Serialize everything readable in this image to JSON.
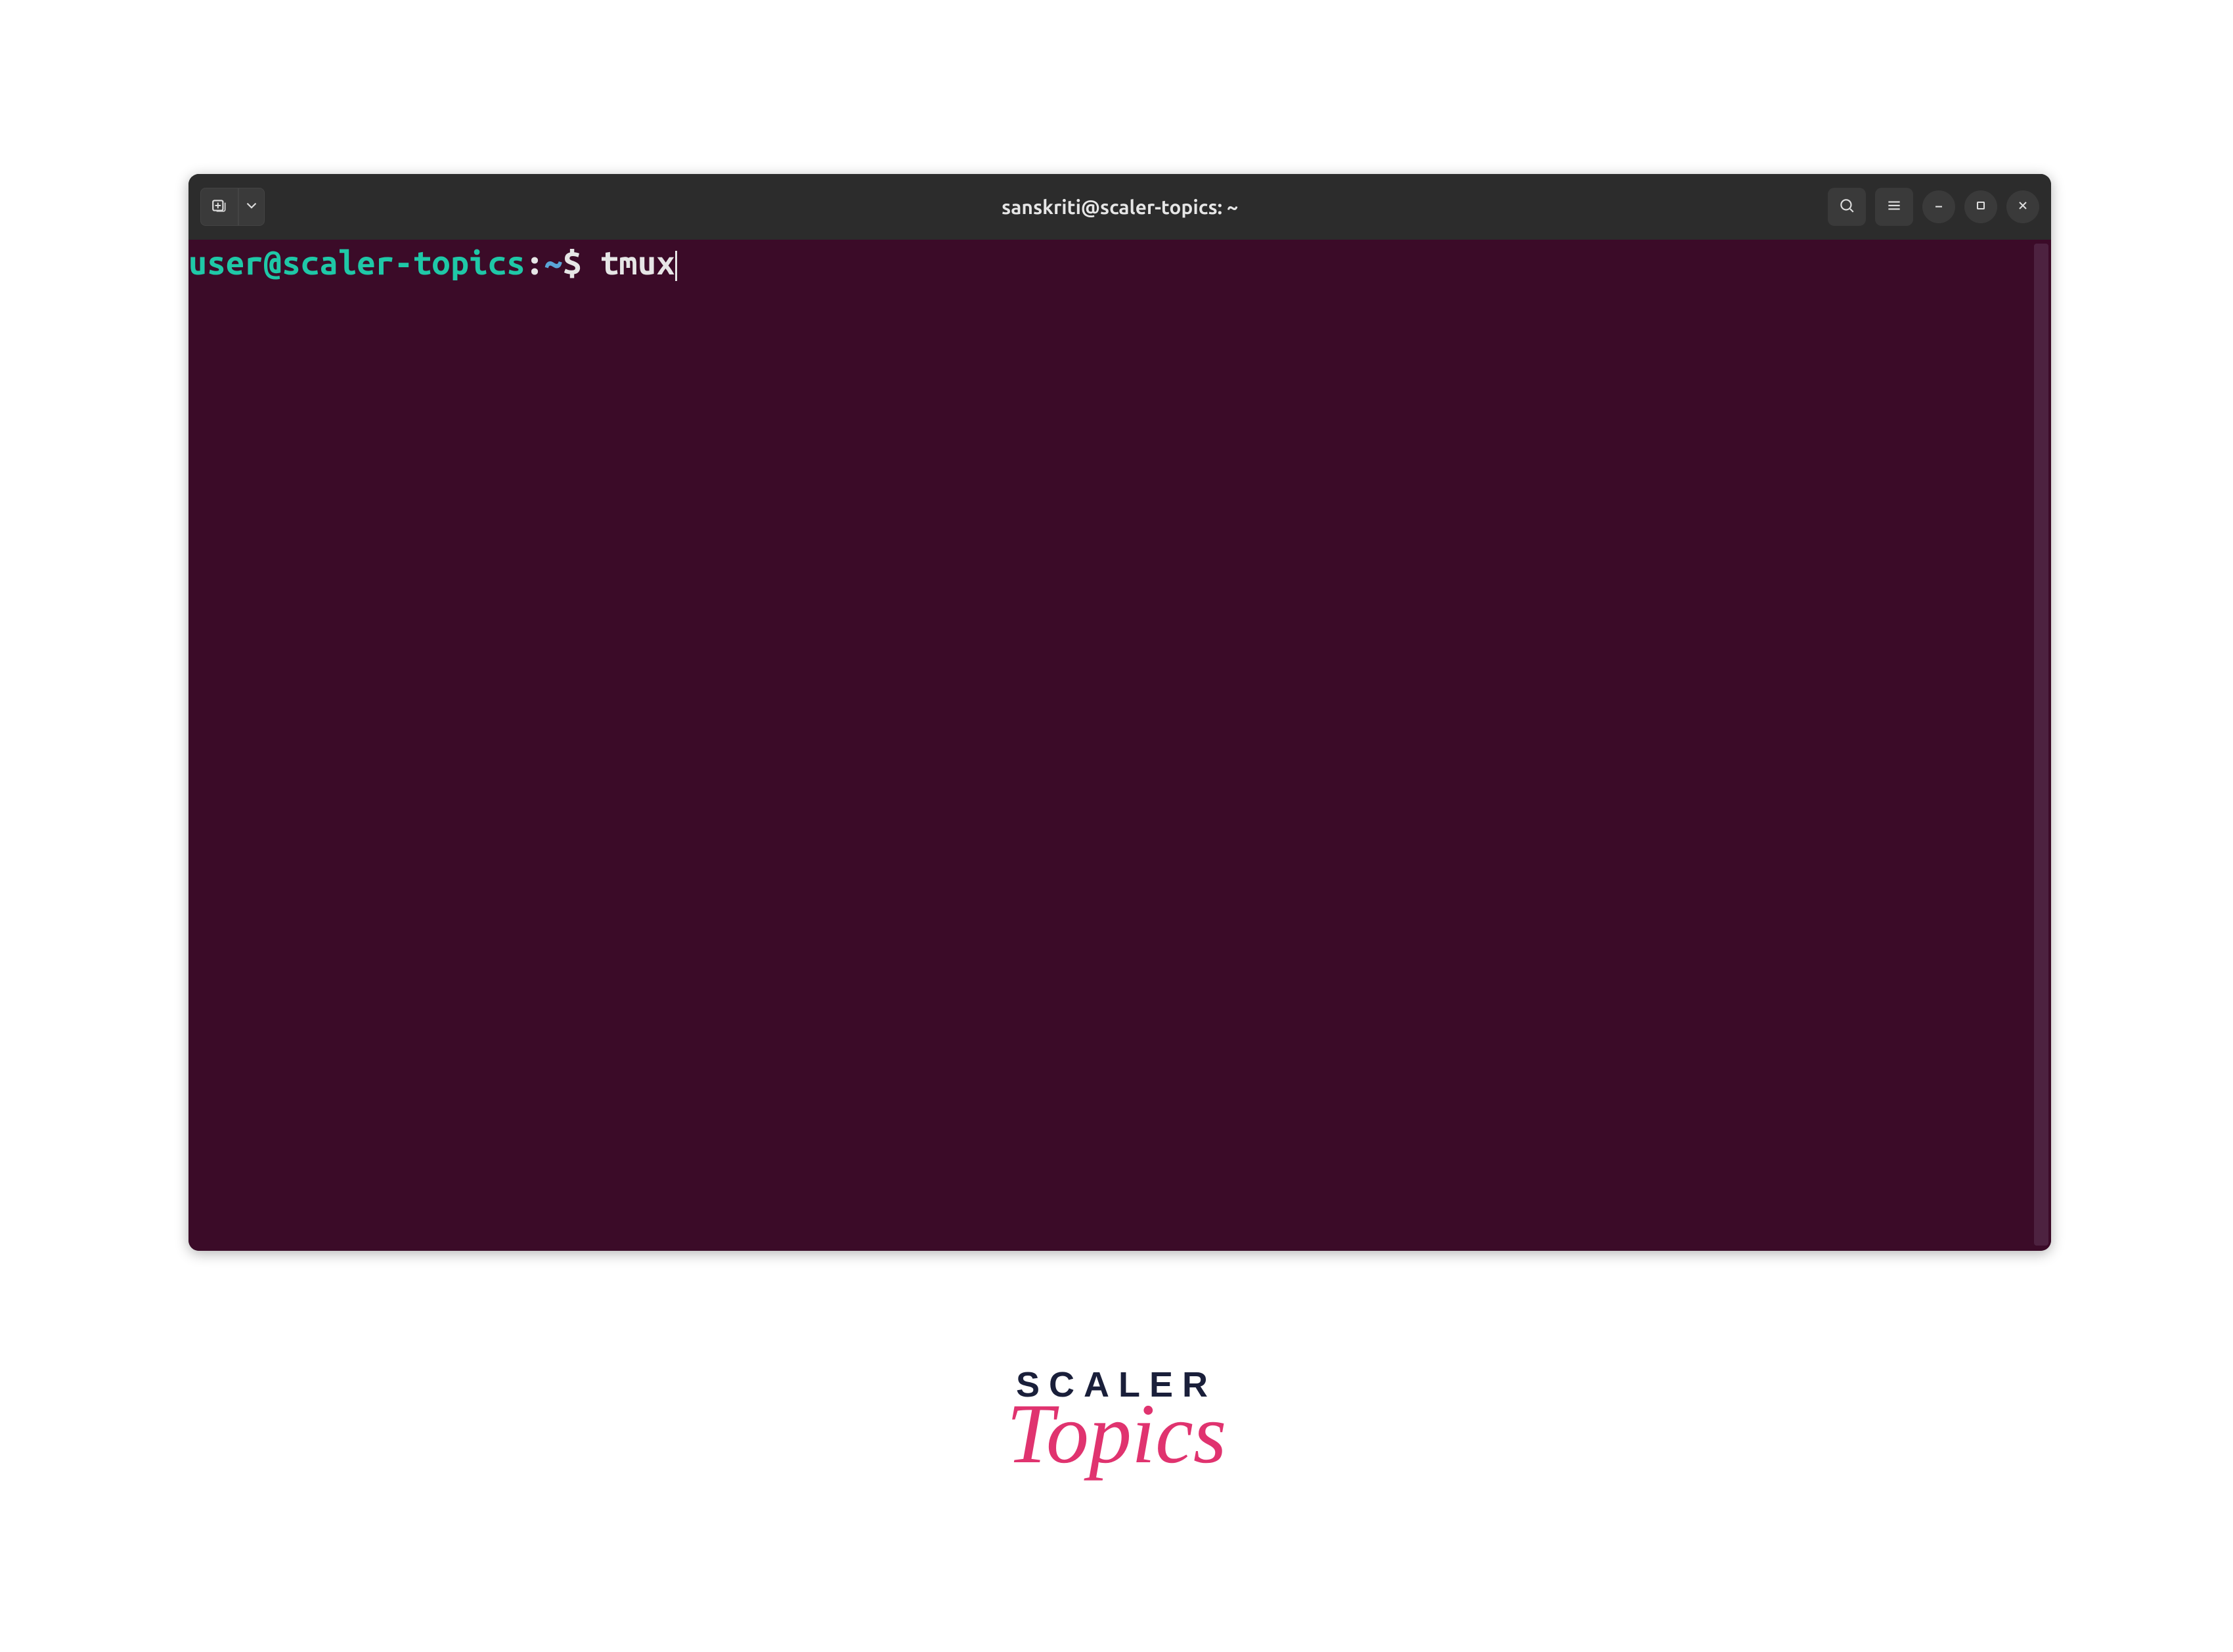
{
  "window": {
    "title": "sanskriti@scaler-topics: ~"
  },
  "terminal": {
    "prompt_user_host": "user@scaler-topics",
    "prompt_colon": ":",
    "prompt_path": "~",
    "prompt_dollar": "$ ",
    "command": "tmux"
  },
  "icons": {
    "new_tab": "new-tab-icon",
    "dropdown": "chevron-down-icon",
    "search": "search-icon",
    "menu": "hamburger-icon",
    "minimize": "minimize-icon",
    "maximize": "maximize-icon",
    "close": "close-icon"
  },
  "logo": {
    "line1": "SCALER",
    "line2": "Topics"
  },
  "colors": {
    "terminal_bg": "#3b0b28",
    "titlebar_bg": "#2c2c2c",
    "prompt_user": "#1fc8a7",
    "prompt_path": "#5aa5d6",
    "text": "#e6e6e6",
    "logo_primary": "#1a1f3a",
    "logo_accent": "#e0336f"
  }
}
